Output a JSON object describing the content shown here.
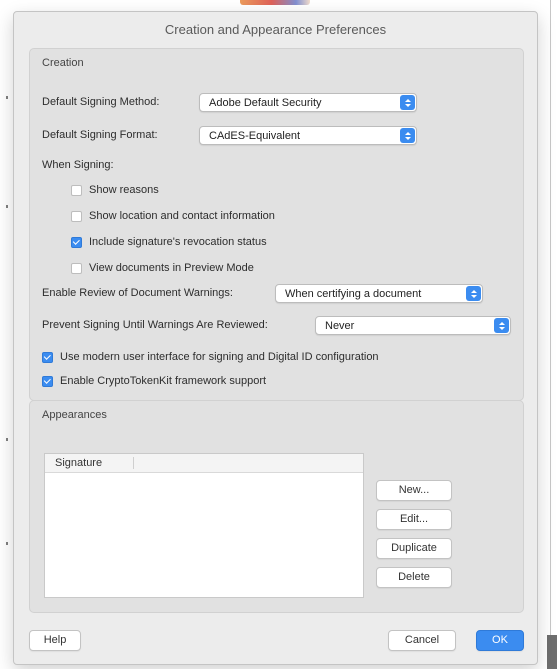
{
  "dialog": {
    "title": "Creation and Appearance Preferences"
  },
  "creation": {
    "group_title": "Creation",
    "signing_method_label": "Default Signing Method:",
    "signing_method_value": "Adobe Default Security",
    "signing_format_label": "Default Signing Format:",
    "signing_format_value": "CAdES-Equivalent",
    "when_signing_label": "When Signing:",
    "options": [
      {
        "label": "Show reasons",
        "checked": false
      },
      {
        "label": "Show location and contact information",
        "checked": false
      },
      {
        "label": "Include signature's revocation status",
        "checked": true
      },
      {
        "label": "View documents in Preview Mode",
        "checked": false
      }
    ],
    "review_label": "Enable Review of Document Warnings:",
    "review_value": "When certifying a document",
    "prevent_label": "Prevent Signing Until Warnings Are Reviewed:",
    "prevent_value": "Never",
    "modern_ui_label": "Use modern user interface for signing and Digital ID configuration",
    "modern_ui_checked": true,
    "cryptotoken_label": "Enable CryptoTokenKit framework support",
    "cryptotoken_checked": true
  },
  "appearances": {
    "group_title": "Appearances",
    "list_header": "Signature",
    "rows": [],
    "buttons": {
      "new": "New...",
      "edit": "Edit...",
      "duplicate": "Duplicate",
      "delete": "Delete"
    }
  },
  "footer": {
    "help": "Help",
    "cancel": "Cancel",
    "ok": "OK"
  },
  "colors": {
    "accent": "#3b8cf0",
    "dialog_bg": "#ececec",
    "group_bg": "#e1e1e1"
  }
}
